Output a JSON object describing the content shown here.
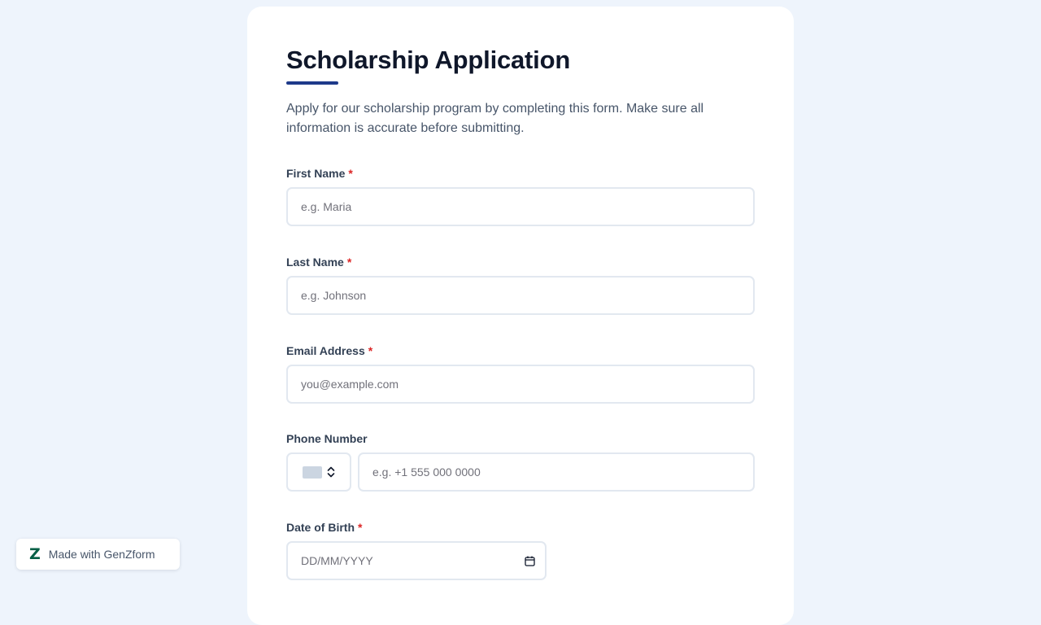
{
  "form": {
    "title": "Scholarship Application",
    "description": "Apply for our scholarship program by completing this form. Make sure all information is accurate before submitting.",
    "fields": {
      "first_name": {
        "label": "First Name",
        "required_mark": "*",
        "placeholder": "e.g. Maria"
      },
      "last_name": {
        "label": "Last Name",
        "required_mark": "*",
        "placeholder": "e.g. Johnson"
      },
      "email": {
        "label": "Email Address",
        "required_mark": "*",
        "placeholder": "you@example.com"
      },
      "phone": {
        "label": "Phone Number",
        "placeholder": "e.g. +1 555 000 0000"
      },
      "dob": {
        "label": "Date of Birth",
        "required_mark": "*",
        "placeholder": "DD/MM/YYYY"
      }
    }
  },
  "badge": {
    "logo": "Z",
    "text": "Made with GenZform"
  },
  "icons": {
    "country_flag": "flag-placeholder-icon",
    "country_chevrons": "chevron-up-down-icon",
    "date_picker": "calendar-icon",
    "brand": "genzform-logo-icon"
  },
  "colors": {
    "page_bg": "#eef4fc",
    "accent": "#1e3a8a",
    "required": "#dc2626",
    "brand": "#065f46"
  }
}
